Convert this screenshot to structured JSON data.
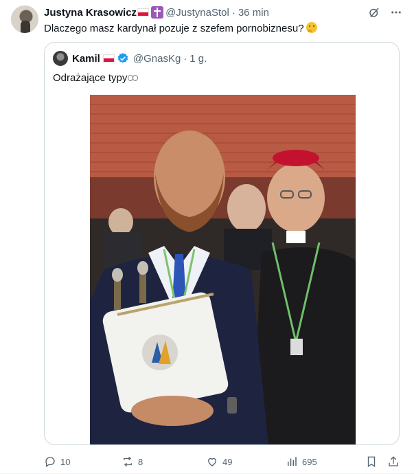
{
  "tweet": {
    "author_name": "Justyna Krasowicz",
    "author_handle": "@JustynaStol",
    "separator": "·",
    "time": "36 min",
    "text": "Dlaczego masz kardynał pozuje z szefem pornobiznesu?",
    "emoji": "thinking-face"
  },
  "quoted": {
    "author_name": "Kamil",
    "author_handle": "@GnasKg",
    "separator": "·",
    "time": "1 g.",
    "text": "Odrażające typy",
    "emoji": "eyes",
    "photo_label": "Two men posing at an outdoor evening event; one holds a Torah scroll in a white embroidered cover, the other wears a cardinal's red zucchetto and pectoral cross."
  },
  "actions": {
    "replies": "10",
    "reposts": "8",
    "likes": "49",
    "views": "695"
  },
  "colors": {
    "text": "#0f1419",
    "muted": "#536471",
    "border": "#cfd9de",
    "verified": "#1d9bf0",
    "flag_red": "#dc143c"
  },
  "icons": [
    "grok-icon",
    "more-icon",
    "reply-icon",
    "repost-icon",
    "like-icon",
    "views-icon",
    "bookmark-icon",
    "share-icon"
  ]
}
